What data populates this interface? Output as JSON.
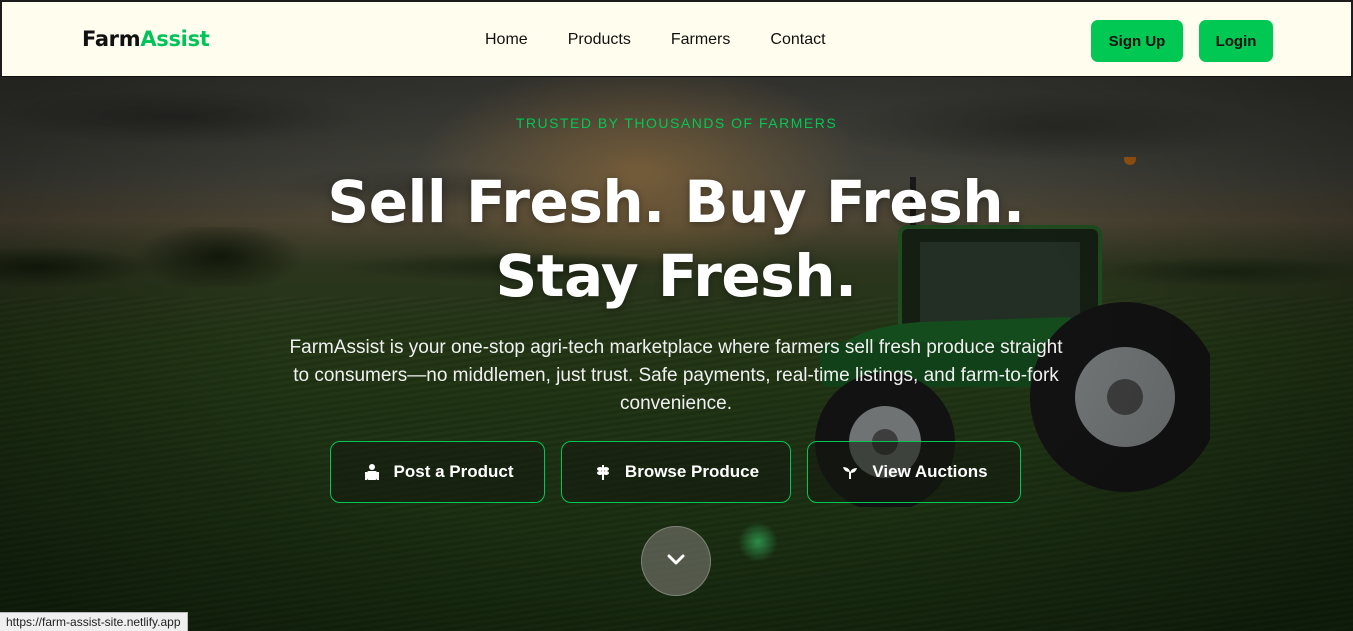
{
  "brand": {
    "name_part1": "Farm",
    "name_part2": "Assist",
    "accent_color": "#00c853"
  },
  "nav": {
    "links": [
      "Home",
      "Products",
      "Farmers",
      "Contact"
    ],
    "signup_label": "Sign Up",
    "login_label": "Login"
  },
  "hero": {
    "tagline": "TRUSTED BY THOUSANDS OF FARMERS",
    "headline": "Sell Fresh. Buy Fresh. Stay Fresh.",
    "description": "FarmAssist is your one-stop agri-tech marketplace where farmers sell fresh produce straight to consumers—no middlemen, just trust. Safe payments, real-time listings, and farm-to-fork convenience.",
    "buttons": [
      {
        "label": "Post a Product",
        "icon": "farmer-icon"
      },
      {
        "label": "Browse Produce",
        "icon": "wheat-icon"
      },
      {
        "label": "View Auctions",
        "icon": "seedling-icon"
      }
    ],
    "scroll_icon": "chevron-down-icon"
  },
  "status_bar": {
    "url": "https://farm-assist-site.netlify.app"
  }
}
